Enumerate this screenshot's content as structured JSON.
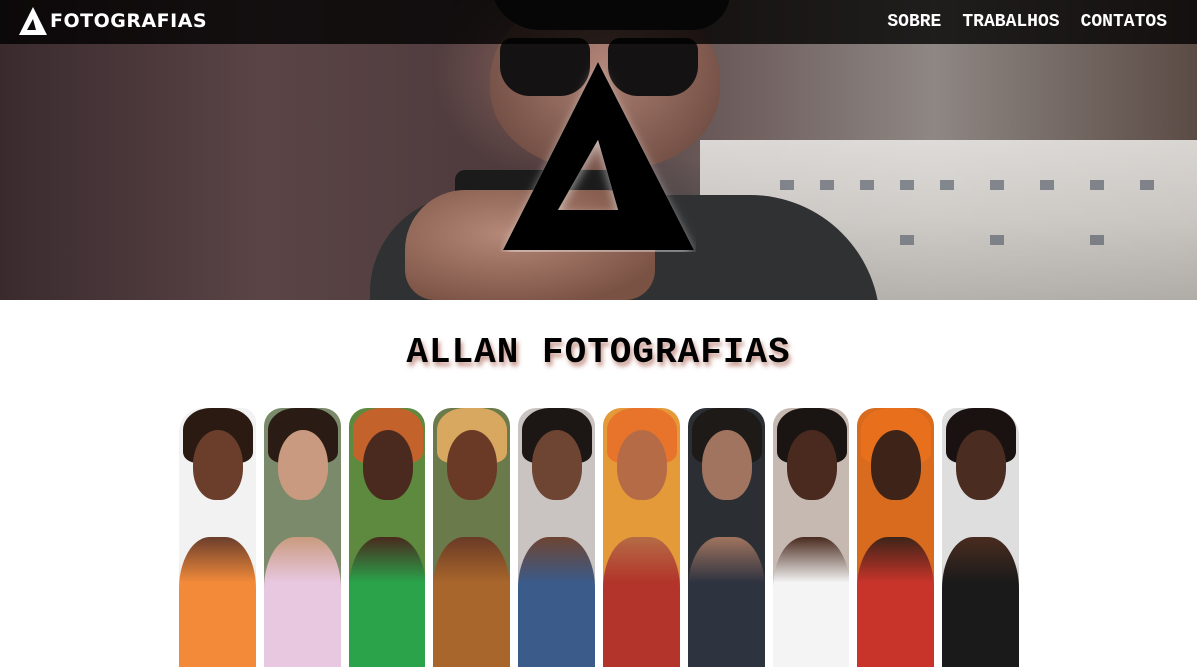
{
  "nav": {
    "brand": "FOTOGRAFIAS",
    "items": [
      "SOBRE",
      "TRABALHOS",
      "CONTATOS"
    ]
  },
  "hero": {
    "logo_icon": "triangle-a-logo-icon"
  },
  "main": {
    "title": "ALLAN FOTOGRAFIAS"
  },
  "colors": {
    "nav_bg": "#000000",
    "nav_text": "#ffffff",
    "title_text": "#000000",
    "title_shadow": "#963c28"
  },
  "gallery": [
    {
      "bg": "#f2f2f2",
      "skin": "#6b3e2c",
      "hair": "#2a1a12",
      "outfit": "#f28a3a"
    },
    {
      "bg": "#7a8a6a",
      "skin": "#c99a7f",
      "hair": "#2a1c14",
      "outfit": "#e8c8e0"
    },
    {
      "bg": "#5d8a3e",
      "skin": "#4a2a1e",
      "hair": "#c4622c",
      "outfit": "#2aa34a"
    },
    {
      "bg": "#6a7a4a",
      "skin": "#6a3a26",
      "hair": "#d9a860",
      "outfit": "#a8662c"
    },
    {
      "bg": "#c9c3c2",
      "skin": "#6e4432",
      "hair": "#1c1614",
      "outfit": "#3b5b8a"
    },
    {
      "bg": "#e59a3a",
      "skin": "#b56c46",
      "hair": "#e8742c",
      "outfit": "#b2342a"
    },
    {
      "bg": "#2b2f34",
      "skin": "#a0745e",
      "hair": "#1e1a18",
      "outfit": "#2e3340"
    },
    {
      "bg": "#c6b9b2",
      "skin": "#4a2a1e",
      "hair": "#1a1412",
      "outfit": "#f4f4f4"
    },
    {
      "bg": "#d86b1e",
      "skin": "#3e2418",
      "hair": "#e8701c",
      "outfit": "#c8342a"
    },
    {
      "bg": "#dedede",
      "skin": "#4a2c20",
      "hair": "#1a1210",
      "outfit": "#1a1a1a"
    }
  ]
}
